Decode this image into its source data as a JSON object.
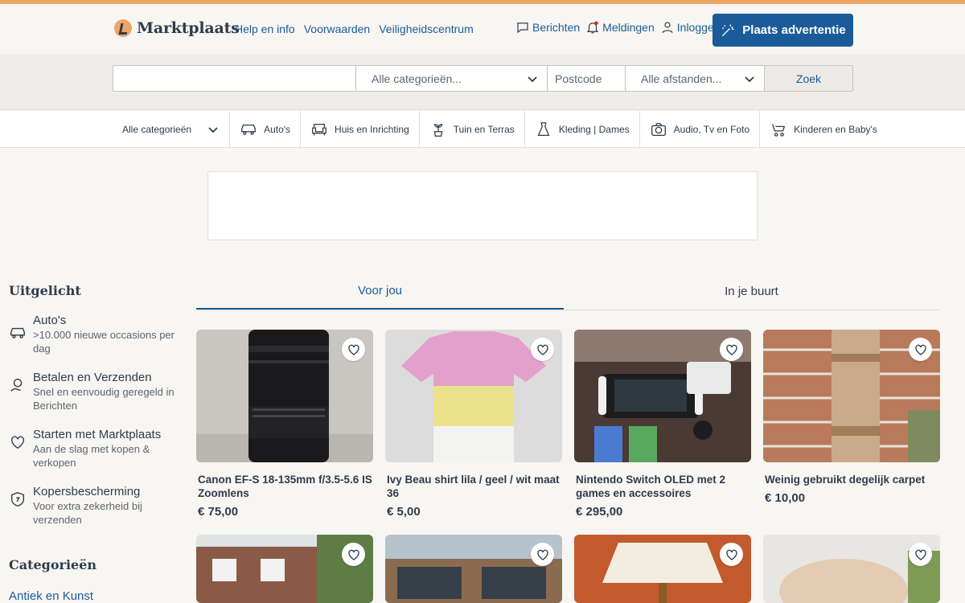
{
  "header": {
    "logo_text": "Marktplaats",
    "links": [
      "Help en info",
      "Voorwaarden",
      "Veiligheidscentrum"
    ],
    "messages_label": "Berichten",
    "notifications_label": "Meldingen",
    "login_label": "Inloggen",
    "place_ad_label": "Plaats advertentie"
  },
  "search": {
    "query_value": "",
    "category_value": "Alle categorieën...",
    "postcode_placeholder": "Postcode",
    "distance_value": "Alle afstanden...",
    "search_button": "Zoek"
  },
  "categories_bar": {
    "all_label": "Alle categorieën",
    "items": [
      "Auto's",
      "Huis en Inrichting",
      "Tuin en Terras",
      "Kleding | Dames",
      "Audio, Tv en Foto",
      "Kinderen en Baby's"
    ]
  },
  "sidebar": {
    "featured_title": "Uitgelicht",
    "items": [
      {
        "title": "Auto's",
        "sub": ">10.000 nieuwe occasions per dag",
        "icon": "car-icon"
      },
      {
        "title": "Betalen en Verzenden",
        "sub": "Snel en eenvoudig geregeld in Berichten",
        "icon": "payment-icon"
      },
      {
        "title": "Starten met Marktplaats",
        "sub": "Aan de slag met kopen & verkopen",
        "icon": "heart-icon"
      },
      {
        "title": "Kopersbescherming",
        "sub": "Voor extra zekerheid bij verzenden",
        "icon": "shield-icon"
      }
    ],
    "categories_title": "Categorieën",
    "first_category": "Antiek en Kunst"
  },
  "tabs": {
    "for_you": "Voor jou",
    "nearby": "In je buurt"
  },
  "listings": [
    {
      "title": "Canon EF-S 18-135mm f/3.5-5.6 IS Zoomlens",
      "price": "€ 75,00"
    },
    {
      "title": "Ivy Beau shirt lila / geel / wit maat 36",
      "price": "€ 5,00"
    },
    {
      "title": "Nintendo Switch OLED met 2 games en accessoires",
      "price": "€ 295,00"
    },
    {
      "title": "Weinig gebruikt degelijk carpet",
      "price": "€ 10,00"
    }
  ],
  "colors": {
    "brand_blue": "#1b5b9a",
    "accent_orange": "#eda566",
    "text_dark": "#2d3c4d"
  }
}
